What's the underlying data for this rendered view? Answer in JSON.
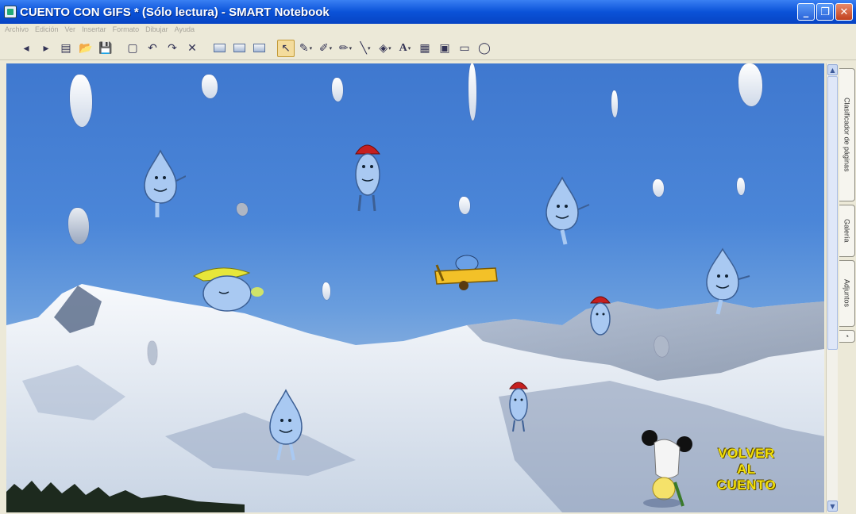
{
  "window": {
    "title": "CUENTO CON GIFS * (Sólo lectura) - SMART Notebook",
    "controls": [
      "minimize",
      "restore",
      "close"
    ]
  },
  "menubar": {
    "items": [
      "Archivo",
      "Edición",
      "Ver",
      "Insertar",
      "Formato",
      "Dibujar",
      "Ayuda"
    ]
  },
  "toolbar": {
    "buttons": [
      "previous-page-icon",
      "next-page-icon",
      "add-page-icon",
      "open-icon",
      "save-icon",
      "paste-icon",
      "undo-icon",
      "redo-icon",
      "delete-icon",
      "screen-shade-icon",
      "full-screen-icon",
      "table-icon",
      "select-icon",
      "pen-icon",
      "creative-pen-icon",
      "highlighter-icon",
      "line-icon",
      "fill-icon",
      "text-icon",
      "properties-icon",
      "move-toolbar-icon",
      "capture-icon",
      "record-icon"
    ]
  },
  "sidebar": {
    "tabs": [
      "Clasificador de páginas",
      "Galería",
      "Adjuntos"
    ]
  },
  "canvas": {
    "scene": "snowy-mountains",
    "link_lines": [
      "VOLVER",
      "AL",
      "CUENTO"
    ]
  },
  "colors": {
    "titlebar": "#0a52d8",
    "link_text": "#f3e00a",
    "sky": "#4b86d8"
  }
}
